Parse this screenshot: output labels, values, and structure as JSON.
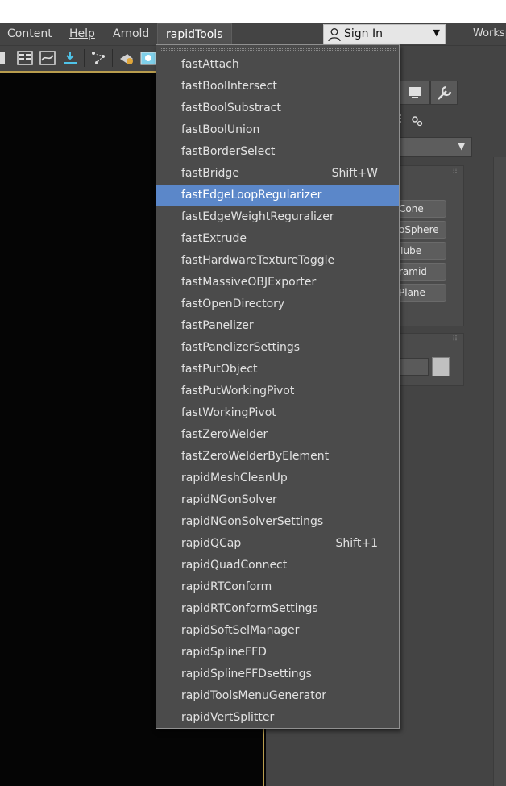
{
  "menubar": {
    "items": [
      {
        "label": "Content",
        "underline": false
      },
      {
        "label": "Help",
        "underline": true
      },
      {
        "label": "Arnold",
        "underline": false
      },
      {
        "label": "rapidTools",
        "underline": false
      }
    ],
    "sign_in_label": "Sign In",
    "workspace_label": "Worksp"
  },
  "command_panel": {
    "object_buttons": [
      "Cone",
      "oSphere",
      "Tube",
      "ramid",
      "Plane"
    ]
  },
  "menu": {
    "active_index": 6,
    "items": [
      {
        "label": "fastAttach",
        "shortcut": ""
      },
      {
        "label": "fastBoolIntersect",
        "shortcut": ""
      },
      {
        "label": "fastBoolSubstract",
        "shortcut": ""
      },
      {
        "label": "fastBoolUnion",
        "shortcut": ""
      },
      {
        "label": "fastBorderSelect",
        "shortcut": ""
      },
      {
        "label": "fastBridge",
        "shortcut": "Shift+W"
      },
      {
        "label": "fastEdgeLoopRegularizer",
        "shortcut": ""
      },
      {
        "label": "fastEdgeWeightReguralizer",
        "shortcut": ""
      },
      {
        "label": "fastExtrude",
        "shortcut": ""
      },
      {
        "label": "fastHardwareTextureToggle",
        "shortcut": ""
      },
      {
        "label": "fastMassiveOBJExporter",
        "shortcut": ""
      },
      {
        "label": "fastOpenDirectory",
        "shortcut": ""
      },
      {
        "label": "fastPanelizer",
        "shortcut": ""
      },
      {
        "label": "fastPanelizerSettings",
        "shortcut": ""
      },
      {
        "label": "fastPutObject",
        "shortcut": ""
      },
      {
        "label": "fastPutWorkingPivot",
        "shortcut": ""
      },
      {
        "label": "fastWorkingPivot",
        "shortcut": ""
      },
      {
        "label": "fastZeroWelder",
        "shortcut": ""
      },
      {
        "label": "fastZeroWelderByElement",
        "shortcut": ""
      },
      {
        "label": "rapidMeshCleanUp",
        "shortcut": ""
      },
      {
        "label": "rapidNGonSolver",
        "shortcut": ""
      },
      {
        "label": "rapidNGonSolverSettings",
        "shortcut": ""
      },
      {
        "label": "rapidQCap",
        "shortcut": "Shift+1"
      },
      {
        "label": "rapidQuadConnect",
        "shortcut": ""
      },
      {
        "label": "rapidRTConform",
        "shortcut": ""
      },
      {
        "label": "rapidRTConformSettings",
        "shortcut": ""
      },
      {
        "label": "rapidSoftSelManager",
        "shortcut": ""
      },
      {
        "label": "rapidSplineFFD",
        "shortcut": ""
      },
      {
        "label": "rapidSplineFFDsettings",
        "shortcut": ""
      },
      {
        "label": "rapidToolsMenuGenerator",
        "shortcut": ""
      },
      {
        "label": "rapidVertSplitter",
        "shortcut": ""
      }
    ]
  },
  "colors": {
    "menu_highlight": "#5b87c9",
    "viewport_border": "#b99d4e",
    "ui_background": "#444444"
  }
}
